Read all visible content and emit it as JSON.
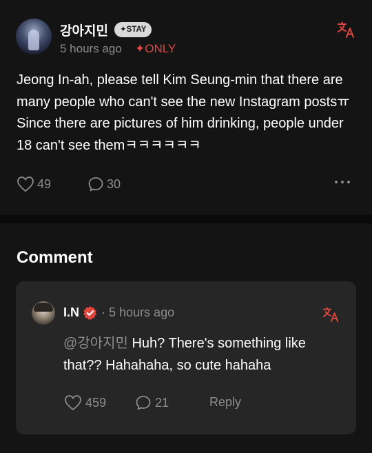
{
  "post": {
    "username": "강아지민",
    "badge": "✦STAY",
    "time": "5 hours ago",
    "only": "✦ONLY",
    "body": "Jeong In-ah, please tell Kim Seung-min that there are many people who can't see the new Instagram postsㅠ Since there are pictures of him drinking, people under 18 can't see themㅋㅋㅋㅋㅋㅋ",
    "likes": "49",
    "comments": "30",
    "icons": [
      "translate-icon",
      "heart-icon",
      "comment-icon",
      "more-icon"
    ],
    "colors": {
      "accent": "#e2473f",
      "muted": "#8c8c8c",
      "background": "#141414",
      "card": "#262626"
    }
  },
  "comment_section": {
    "heading": "Comment",
    "comment": {
      "author": "I.N",
      "separator": "·",
      "time": "5 hours ago",
      "mention": "@강아지민",
      "text": " Huh? There's something like that?? Hahahaha, so cute hahaha",
      "likes": "459",
      "replies": "21",
      "reply_label": "Reply",
      "icons": [
        "verified-icon",
        "translate-icon",
        "heart-icon",
        "comment-icon"
      ]
    }
  }
}
